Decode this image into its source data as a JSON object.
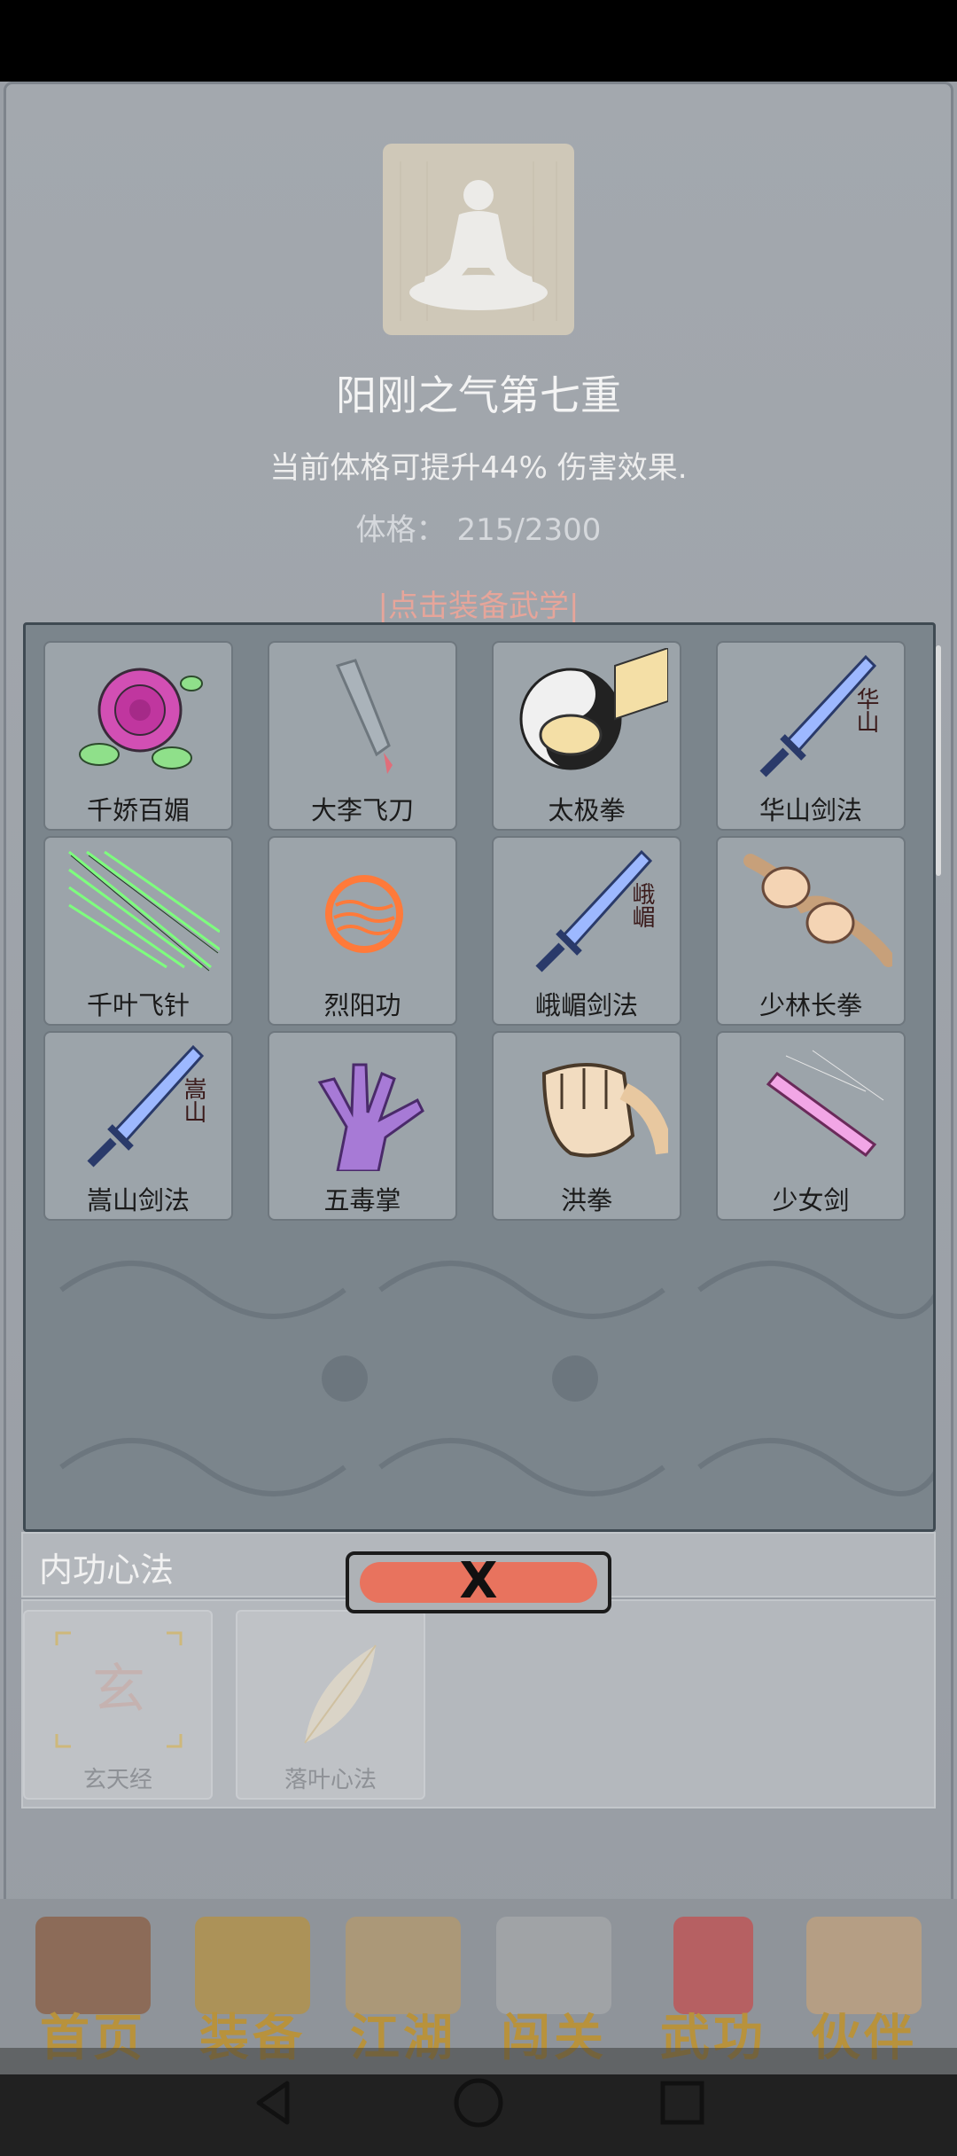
{
  "skill": {
    "title": "阳刚之气第七重",
    "description": "当前体格可提升44% 伤害效果.",
    "physique_label": "体格：",
    "physique_value": "215/2300",
    "equip_link": "|点击装备武学|"
  },
  "skills": [
    {
      "label": "千娇百媚",
      "icon": "rose-icon"
    },
    {
      "label": "大李飞刀",
      "icon": "flying-knife-icon"
    },
    {
      "label": "太极拳",
      "icon": "taiji-fist-icon"
    },
    {
      "label": "华山剑法",
      "icon": "sword-icon",
      "glyph": "华山"
    },
    {
      "label": "千叶飞针",
      "icon": "flying-needles-icon"
    },
    {
      "label": "烈阳功",
      "icon": "sun-orb-icon"
    },
    {
      "label": "峨嵋剑法",
      "icon": "sword-icon",
      "glyph": "峨嵋"
    },
    {
      "label": "少林长拳",
      "icon": "long-fist-icon"
    },
    {
      "label": "嵩山剑法",
      "icon": "sword-icon",
      "glyph": "嵩山"
    },
    {
      "label": "五毒掌",
      "icon": "poison-palm-icon"
    },
    {
      "label": "洪拳",
      "icon": "fist-icon"
    },
    {
      "label": "少女剑",
      "icon": "pink-sword-icon"
    }
  ],
  "inner_arts": {
    "title": "内功心法",
    "items": [
      {
        "label": "玄天经",
        "glyph": "玄"
      },
      {
        "label": "落叶心法"
      }
    ]
  },
  "close_button": {
    "label": "X"
  },
  "tabs": [
    {
      "label": "首页"
    },
    {
      "label": "装备"
    },
    {
      "label": "江湖"
    },
    {
      "label": "闯关"
    },
    {
      "label": "武功"
    },
    {
      "label": "伙伴"
    }
  ],
  "colors": {
    "background": "#9a9fa6",
    "panel": "#7b858c",
    "card": "#9ca4aa",
    "close": "#e8735e",
    "tab_text": "#b8923c"
  }
}
